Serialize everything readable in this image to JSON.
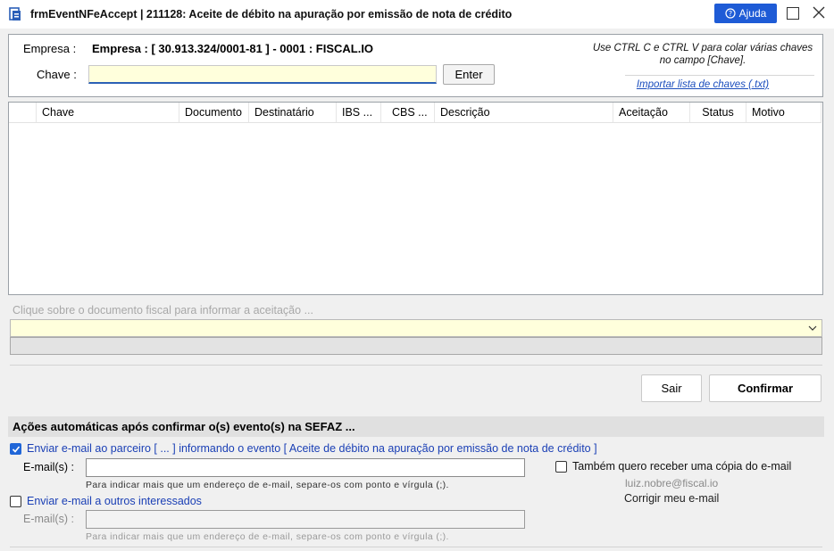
{
  "window": {
    "title": "frmEventNFeAccept | 211128: Aceite de débito na apuração por emissão de nota de crédito",
    "help_label": "Ajuda"
  },
  "header": {
    "empresa_label": "Empresa :",
    "empresa_value": "Empresa : [ 30.913.324/0001-81 ] - 0001 : FISCAL.IO",
    "chave_label": "Chave :",
    "chave_value": "",
    "enter_label": "Enter",
    "hint": "Use CTRL C e CTRL V para colar várias chaves no campo [Chave].",
    "import_link": "Importar lista de chaves (.txt)"
  },
  "grid": {
    "columns": [
      "Chave",
      "Documento",
      "Destinatário",
      "IBS ...",
      "CBS ...",
      "Descrição",
      "Aceitação",
      "Status",
      "Motivo"
    ],
    "rows": []
  },
  "instruction": "Clique sobre o documento fiscal para informar a aceitação ...",
  "combo_value": "",
  "buttons": {
    "sair": "Sair",
    "confirmar": "Confirmar"
  },
  "actions": {
    "section_title": "Ações automáticas após confirmar o(s) evento(s) na SEFAZ ...",
    "option1_label": "Enviar e-mail ao parceiro [  ... ] informando o evento [ Aceite de débito na apuração por emissão de nota de crédito ]",
    "option1_checked": true,
    "email1_label": "E-mail(s) :",
    "email1_value": "",
    "email_hint": "Para indicar mais que um endereço de e-mail, separe-os com ponto e vírgula (;).",
    "copy_label": "Também quero receber uma cópia do e-mail",
    "copy_checked": false,
    "user_email": "luiz.nobre@fiscal.io",
    "change_email": "Corrigir meu e-mail",
    "option2_label": "Enviar e-mail a outros interessados",
    "option2_checked": false,
    "email2_label": "E-mail(s) :",
    "email2_value": ""
  },
  "colors": {
    "accent": "#1e5bd6",
    "link": "#1a4dbd",
    "input_yellow": "#ffffdc"
  }
}
